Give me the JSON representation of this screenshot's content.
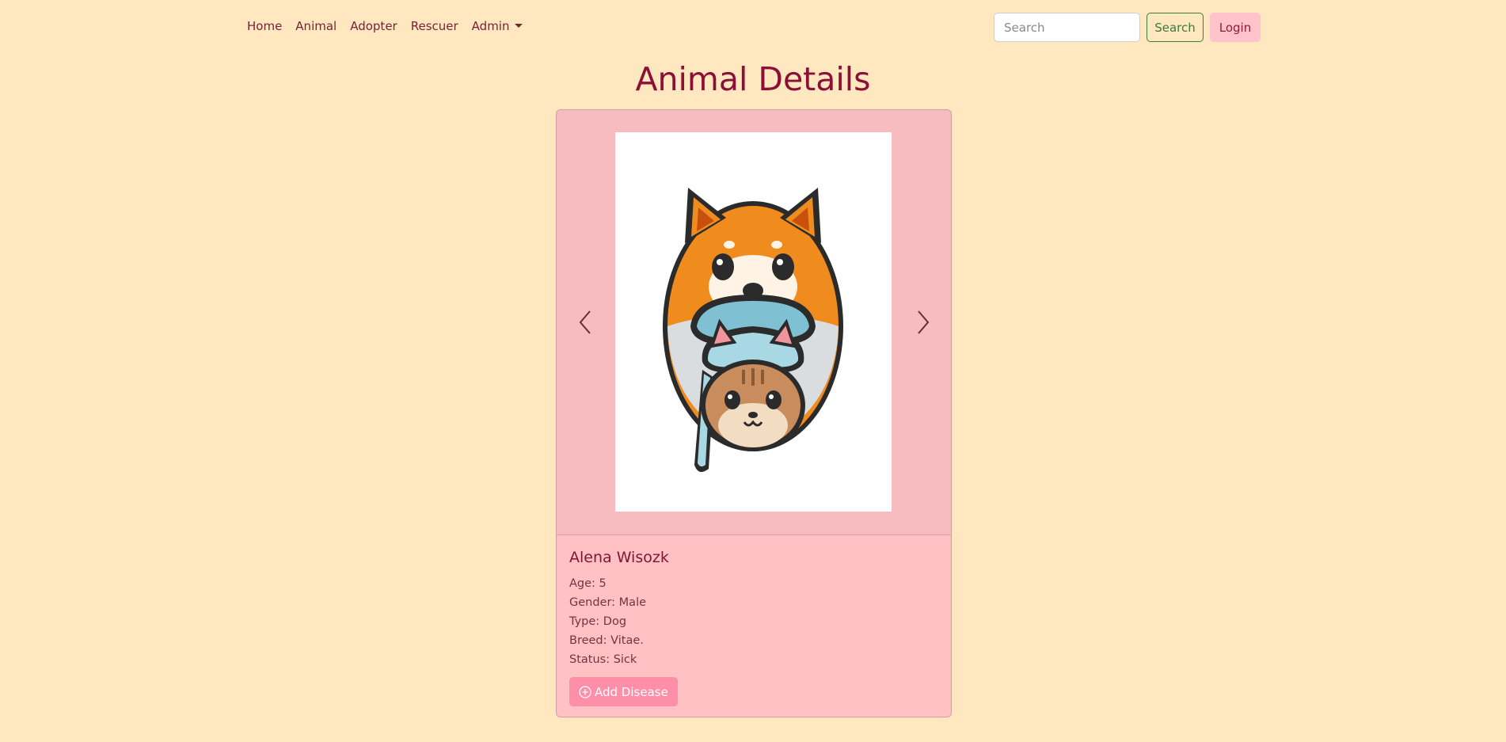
{
  "nav": {
    "links": [
      {
        "label": "Home"
      },
      {
        "label": "Animal"
      },
      {
        "label": "Adopter"
      },
      {
        "label": "Rescuer"
      },
      {
        "label": "Admin"
      }
    ],
    "search": {
      "placeholder": "Search",
      "button_label": "Search"
    },
    "login_label": "Login"
  },
  "page": {
    "title": "Animal Details"
  },
  "animal": {
    "name": "Alena Wisozk",
    "age": "Age: 5",
    "gender": "Gender: Male",
    "type": "Type: Dog",
    "breed": "Breed: Vitae.",
    "status": "Status: Sick",
    "add_disease_label": "Add Disease"
  },
  "icons": {
    "admin_dropdown": "caret-down-icon",
    "prev": "chevron-left-icon",
    "next": "chevron-right-icon",
    "add": "plus-circle-icon"
  },
  "colors": {
    "background": "#ffe7bf",
    "card": "#ffc1c3",
    "title": "#8c0f38",
    "accent_button": "#ff8fa8"
  }
}
